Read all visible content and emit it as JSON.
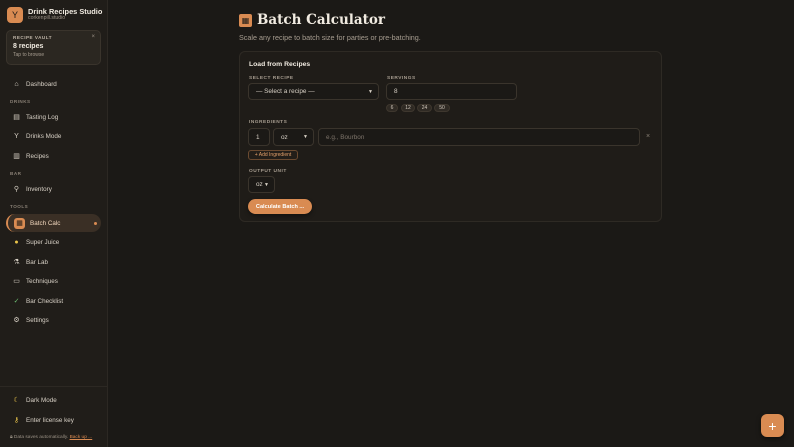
{
  "brand": {
    "title": "Drink Recipes Studio",
    "subtitle": "corkenpill.studio"
  },
  "vault": {
    "label": "RECIPE VAULT",
    "count": "8 recipes",
    "hint": "Tap to browse",
    "close": "×"
  },
  "nav": {
    "dashboard": {
      "icon": "home-icon",
      "glyph": "⌂",
      "label": "Dashboard"
    },
    "section_drinks": "DRINKS",
    "tasting": {
      "icon": "notebook-icon",
      "glyph": "▤",
      "label": "Tasting Log"
    },
    "drinks_mode": {
      "icon": "cocktail-icon",
      "glyph": "Y",
      "label": "Drinks Mode"
    },
    "recipes": {
      "icon": "books-icon",
      "glyph": "▥",
      "label": "Recipes"
    },
    "section_bar": "BAR",
    "inventory": {
      "icon": "bottle-icon",
      "glyph": "⚲",
      "label": "Inventory"
    },
    "section_tools": "TOOLS",
    "batch": {
      "icon": "abacus-icon",
      "glyph": "▦",
      "label": "Batch Calc"
    },
    "super_juice": {
      "icon": "lemon-icon",
      "glyph": "●",
      "label": "Super Juice"
    },
    "bar_lab": {
      "icon": "test-tube-icon",
      "glyph": "⚗",
      "label": "Bar Lab"
    },
    "techniques": {
      "icon": "book-icon",
      "glyph": "▭",
      "label": "Techniques"
    },
    "checklist": {
      "icon": "checkbox-icon",
      "glyph": "✓",
      "label": "Bar Checklist"
    },
    "settings": {
      "icon": "gear-icon",
      "glyph": "⚙",
      "label": "Settings"
    },
    "dark_mode": {
      "icon": "moon-icon",
      "glyph": "☾",
      "label": "Dark Mode"
    },
    "license": {
      "icon": "key-icon",
      "glyph": "⚷",
      "label": "Enter license key"
    }
  },
  "save_note": {
    "text": "Data saves automatically.",
    "link": "Back up ..."
  },
  "page": {
    "title": "Batch Calculator",
    "subtitle": "Scale any recipe to batch size for parties or pre-batching."
  },
  "form": {
    "card_title": "Load from Recipes",
    "select_label": "SELECT RECIPE",
    "select_value": "— Select a recipe —",
    "servings_label": "SERVINGS",
    "servings_value": "8",
    "servings_presets": [
      "6",
      "12",
      "24",
      "50"
    ],
    "ingredients_label": "INGREDIENTS",
    "ingredient_amount": "1",
    "ingredient_unit": "oz",
    "ingredient_name_placeholder": "e.g., Bourbon",
    "add_ingredient": "+ Add Ingredient",
    "output_unit_label": "OUTPUT UNIT",
    "output_unit_value": "oz",
    "calculate": "Calculate Batch ..."
  },
  "fab": "+",
  "colors": {
    "accent": "#d98b52",
    "background": "#1b1916",
    "sidebar": "#201d19"
  }
}
